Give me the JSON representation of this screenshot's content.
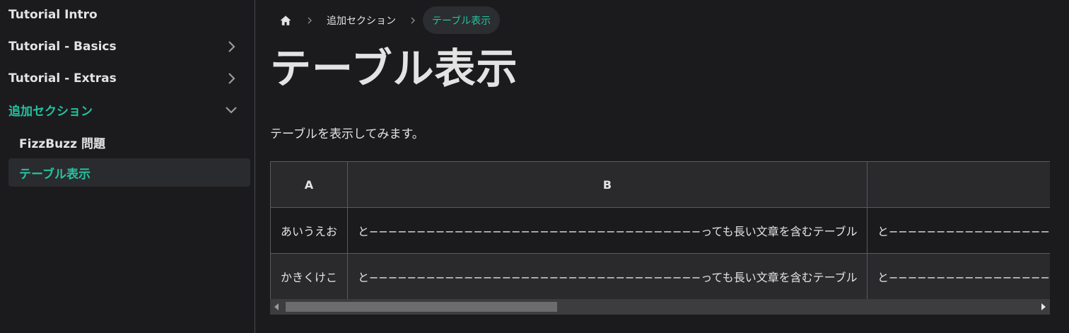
{
  "sidebar": {
    "items": [
      {
        "label": "Tutorial Intro"
      },
      {
        "label": "Tutorial - Basics",
        "chevron": "chevron-right"
      },
      {
        "label": "Tutorial - Extras",
        "chevron": "chevron-right"
      },
      {
        "label": "追加セクション",
        "chevron": "chevron-down"
      },
      {
        "label": "FizzBuzz 問題"
      },
      {
        "label": "テーブル表示"
      }
    ]
  },
  "breadcrumb": {
    "home_icon": "home-icon",
    "section": "追加セクション",
    "current": "テーブル表示"
  },
  "page": {
    "title": "テーブル表示",
    "description": "テーブルを表示してみます。"
  },
  "table": {
    "headers": [
      "A",
      "B",
      ""
    ],
    "rows": [
      [
        "あいうえお",
        "と−−−−−−−−−−−−−−−−−−−−−−−−−−−−−−−−−−−っても長い文章を含むテーブル",
        "と−−−−−−−−−−−−−−−−−−−−−−−−−−−−−−−−−−−っても長い文章を含むテーブル"
      ],
      [
        "かきくけこ",
        "と−−−−−−−−−−−−−−−−−−−−−−−−−−−−−−−−−−−っても長い文章を含むテーブル",
        "と−−−−−−−−−−−−−−−−−−−−−−−−−−−−−−−−−−−っても長い文章を含むテーブル"
      ]
    ]
  },
  "colors": {
    "accent": "#25c2a0",
    "background": "#1b1b1d",
    "text": "#e3e3e3"
  }
}
